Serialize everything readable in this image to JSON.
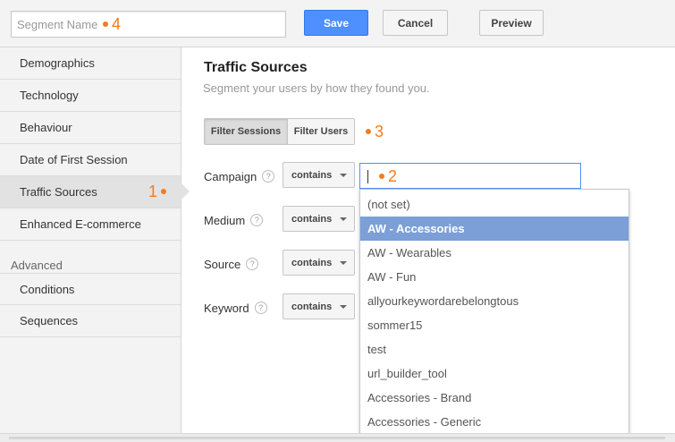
{
  "toolbar": {
    "segment_placeholder": "Segment Name",
    "save_label": "Save",
    "cancel_label": "Cancel",
    "preview_label": "Preview"
  },
  "markers": {
    "m1": "1",
    "m2": "2",
    "m3": "3",
    "m4": "4"
  },
  "sidebar": {
    "items": [
      {
        "label": "Demographics"
      },
      {
        "label": "Technology"
      },
      {
        "label": "Behaviour"
      },
      {
        "label": "Date of First Session"
      },
      {
        "label": "Traffic Sources"
      },
      {
        "label": "Enhanced E-commerce"
      }
    ],
    "section_label": "Advanced",
    "advanced_items": [
      {
        "label": "Conditions"
      },
      {
        "label": "Sequences"
      }
    ]
  },
  "main": {
    "title": "Traffic Sources",
    "subtitle": "Segment your users by how they found you.",
    "filter_sessions": "Filter Sessions",
    "filter_users": "Filter Users",
    "rows": [
      {
        "label": "Campaign",
        "operator": "contains"
      },
      {
        "label": "Medium",
        "operator": "contains"
      },
      {
        "label": "Source",
        "operator": "contains"
      },
      {
        "label": "Keyword",
        "operator": "contains"
      }
    ],
    "help_glyph": "?"
  },
  "dropdown": {
    "options": [
      "(not set)",
      "AW - Accessories",
      "AW - Wearables",
      "AW - Fun",
      "allyourkeywordarebelongtous",
      "sommer15",
      "test",
      "url_builder_tool",
      "Accessories - Brand",
      "Accessories - Generic"
    ],
    "highlighted": "AW - Accessories"
  },
  "colors": {
    "accent": "#4d90fe",
    "marker": "#f27c21",
    "highlight": "#7b9fd6"
  }
}
